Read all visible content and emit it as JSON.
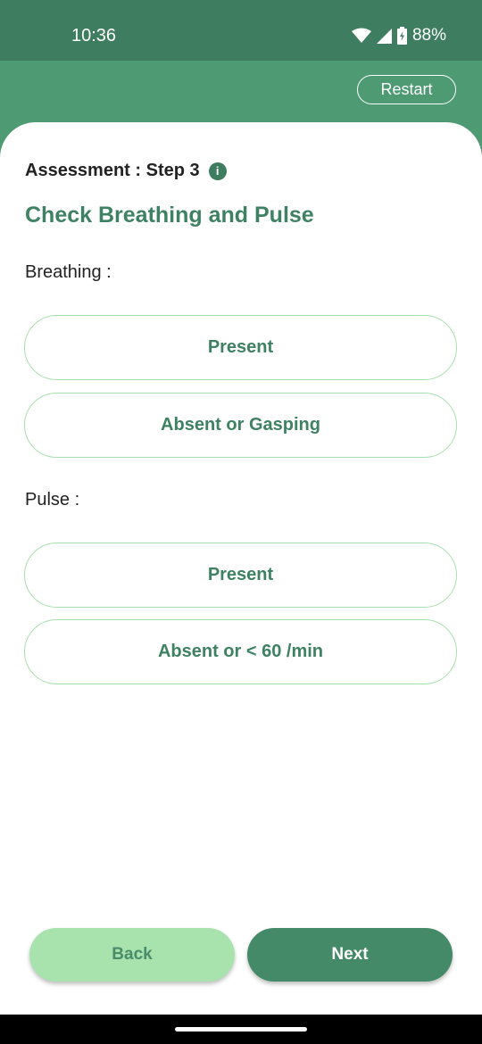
{
  "status_bar": {
    "time": "10:36",
    "battery_percent": "88%",
    "icons": [
      "wifi-icon",
      "signal-icon",
      "battery-charging-icon"
    ]
  },
  "header": {
    "restart_label": "Restart"
  },
  "assessment": {
    "step_label": "Assessment : Step 3",
    "info_icon": "i",
    "title": "Check Breathing and Pulse"
  },
  "breathing": {
    "label": "Breathing :",
    "options": [
      "Present",
      "Absent or Gasping"
    ]
  },
  "pulse": {
    "label": "Pulse :",
    "options": [
      "Present",
      "Absent or < 60 /min"
    ]
  },
  "footer": {
    "back_label": "Back",
    "next_label": "Next"
  },
  "colors": {
    "header_dark": "#3e7d5f",
    "header_light": "#4e9a73",
    "accent_text": "#3e8163",
    "option_border": "#a9dfae",
    "back_bg": "#a8e3ae",
    "next_bg": "#458a68"
  }
}
